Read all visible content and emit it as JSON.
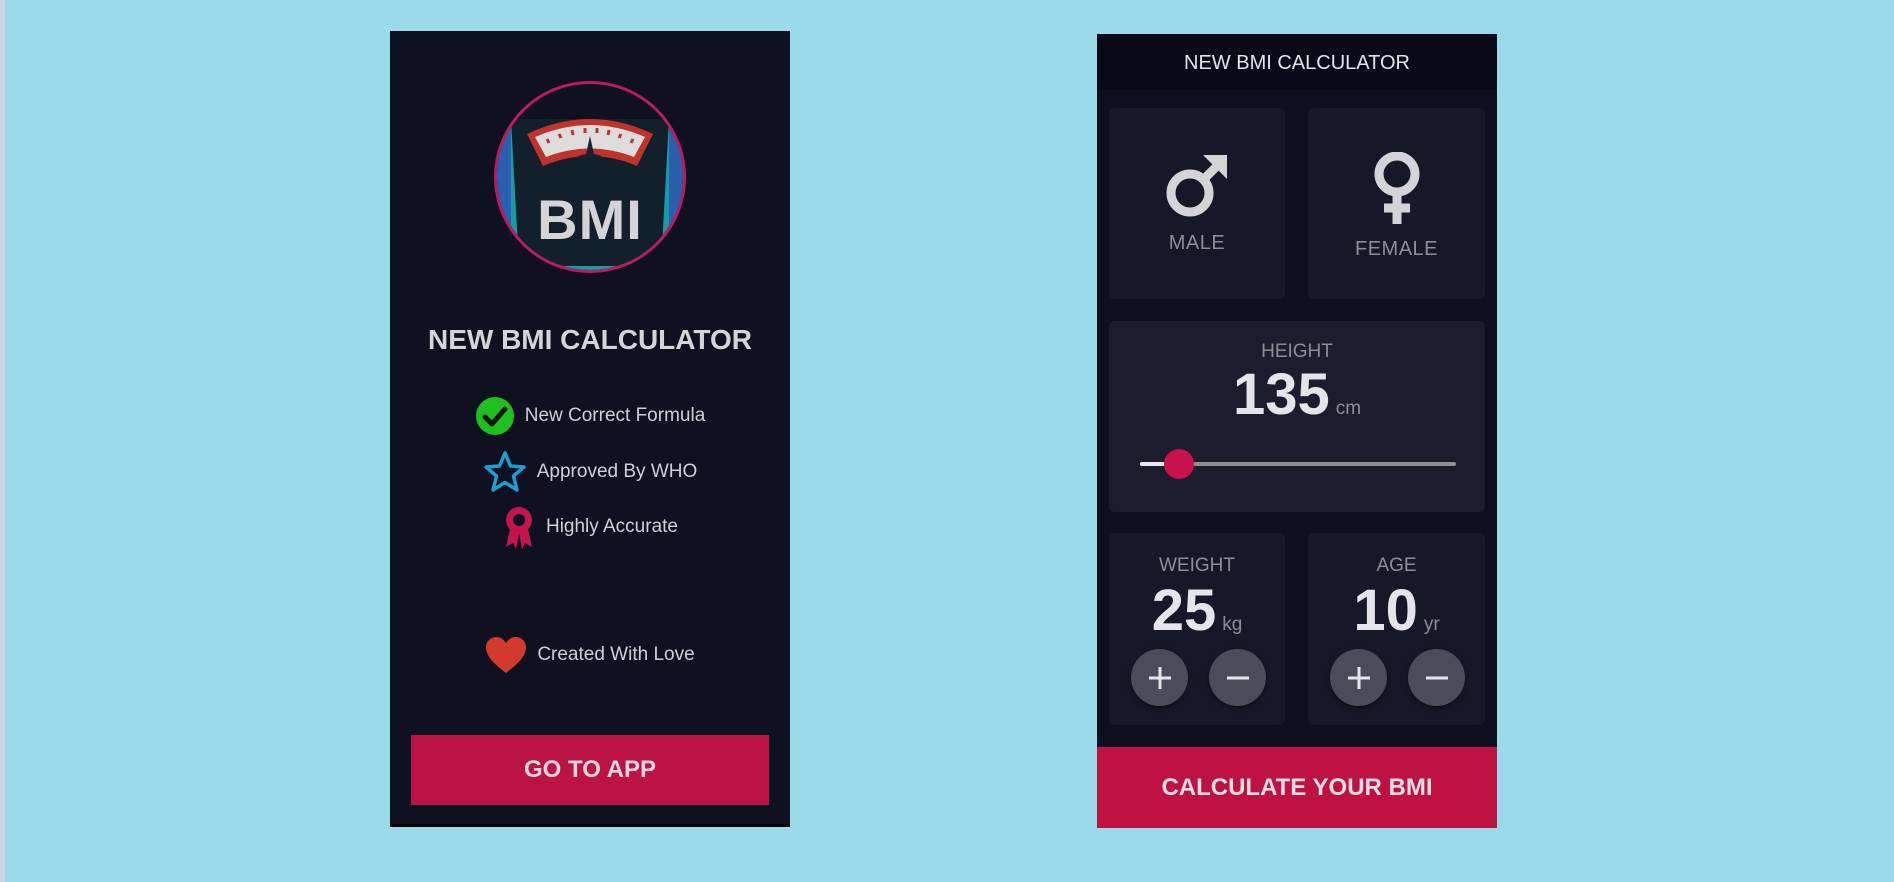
{
  "splash": {
    "logo_text": "BMI",
    "title": "NEW BMI CALCULATOR",
    "features": [
      {
        "icon": "check-circle-icon",
        "label": "New Correct Formula",
        "color": "#1fbf1f"
      },
      {
        "icon": "star-outline-icon",
        "label": "Approved By WHO",
        "color": "#1a9fd4"
      },
      {
        "icon": "award-ribbon-icon",
        "label": "Highly Accurate",
        "color": "#c2154c"
      }
    ],
    "footer_note": {
      "icon": "heart-icon",
      "label": "Created With Love",
      "color": "#d23a2e"
    },
    "cta_label": "GO TO APP"
  },
  "calculator": {
    "app_title": "NEW BMI CALCULATOR",
    "gender": {
      "male": {
        "icon": "male-symbol-icon",
        "label": "MALE"
      },
      "female": {
        "icon": "female-symbol-icon",
        "label": "FEMALE"
      }
    },
    "height": {
      "label": "HEIGHT",
      "value": "135",
      "unit": "cm"
    },
    "weight": {
      "label": "WEIGHT",
      "value": "25",
      "unit": "kg"
    },
    "age": {
      "label": "AGE",
      "value": "10",
      "unit": "yr"
    },
    "calculate_label": "CALCULATE YOUR BMI"
  },
  "colors": {
    "background": "#9adaea",
    "screen_bg": "#0f1020",
    "card_bg": "#161827",
    "accent": "#bb1343"
  }
}
